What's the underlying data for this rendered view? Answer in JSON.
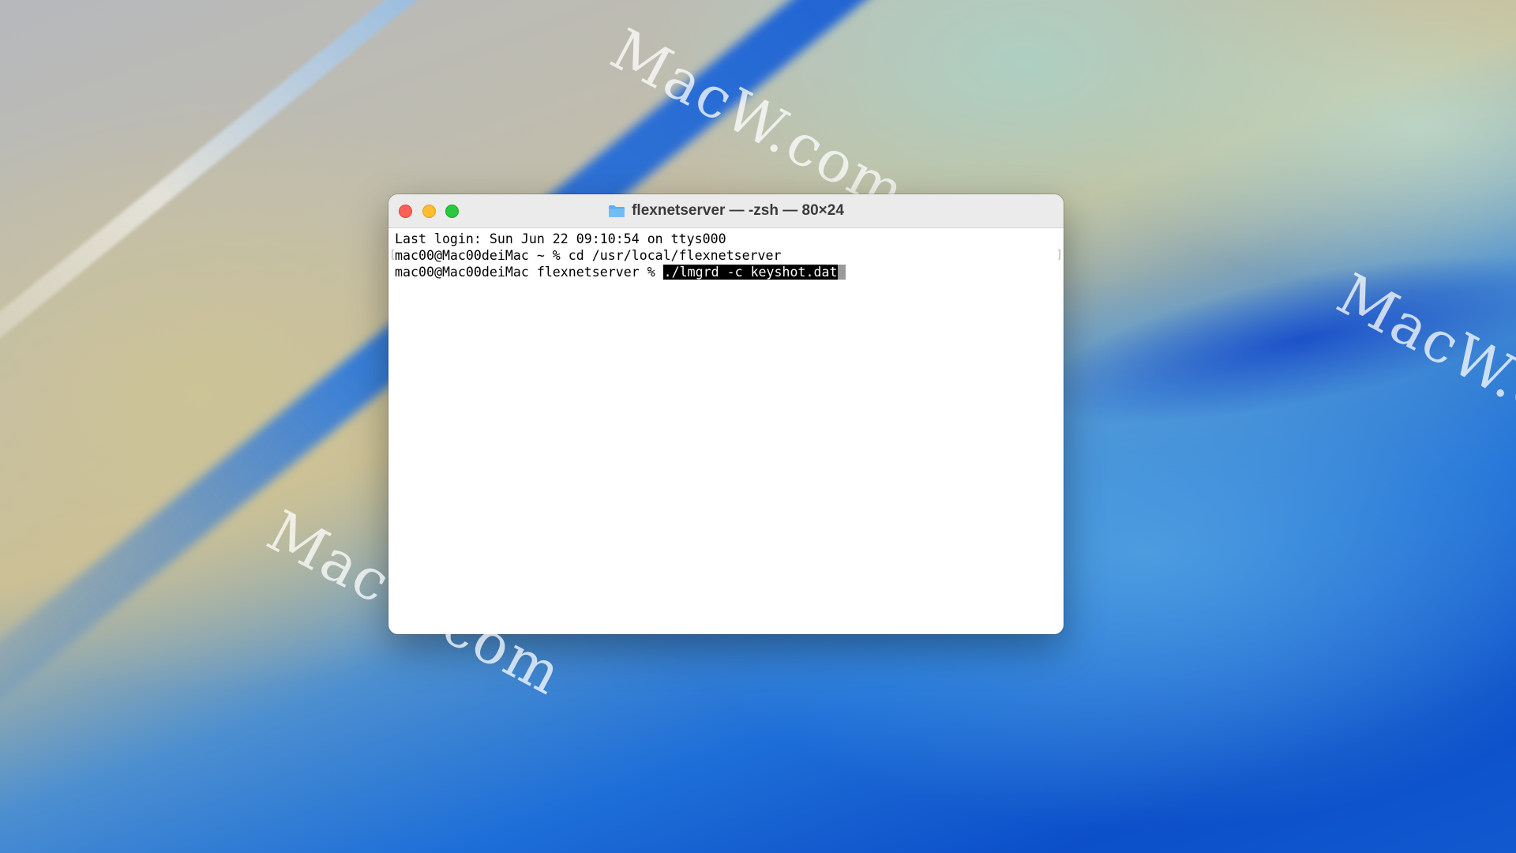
{
  "window": {
    "title": "flexnetserver — -zsh — 80×24",
    "title_icon": "folder-icon"
  },
  "terminal": {
    "lines": [
      "Last login: Sun Jun 22 09:10:54 on ttys000",
      "mac00@Mac00deiMac ~ % cd /usr/local/flexnetserver"
    ],
    "prompt": "mac00@Mac00deiMac flexnetserver % ",
    "current_command": "./lmgrd -c keyshot.dat"
  },
  "watermarks": [
    "MacW.com",
    "MacW.com",
    "MacW.com"
  ],
  "colors": {
    "close": "#fe5f57",
    "minimize": "#febc2e",
    "zoom": "#28c840",
    "folder": "#5aaef0",
    "selection": "#000000"
  }
}
